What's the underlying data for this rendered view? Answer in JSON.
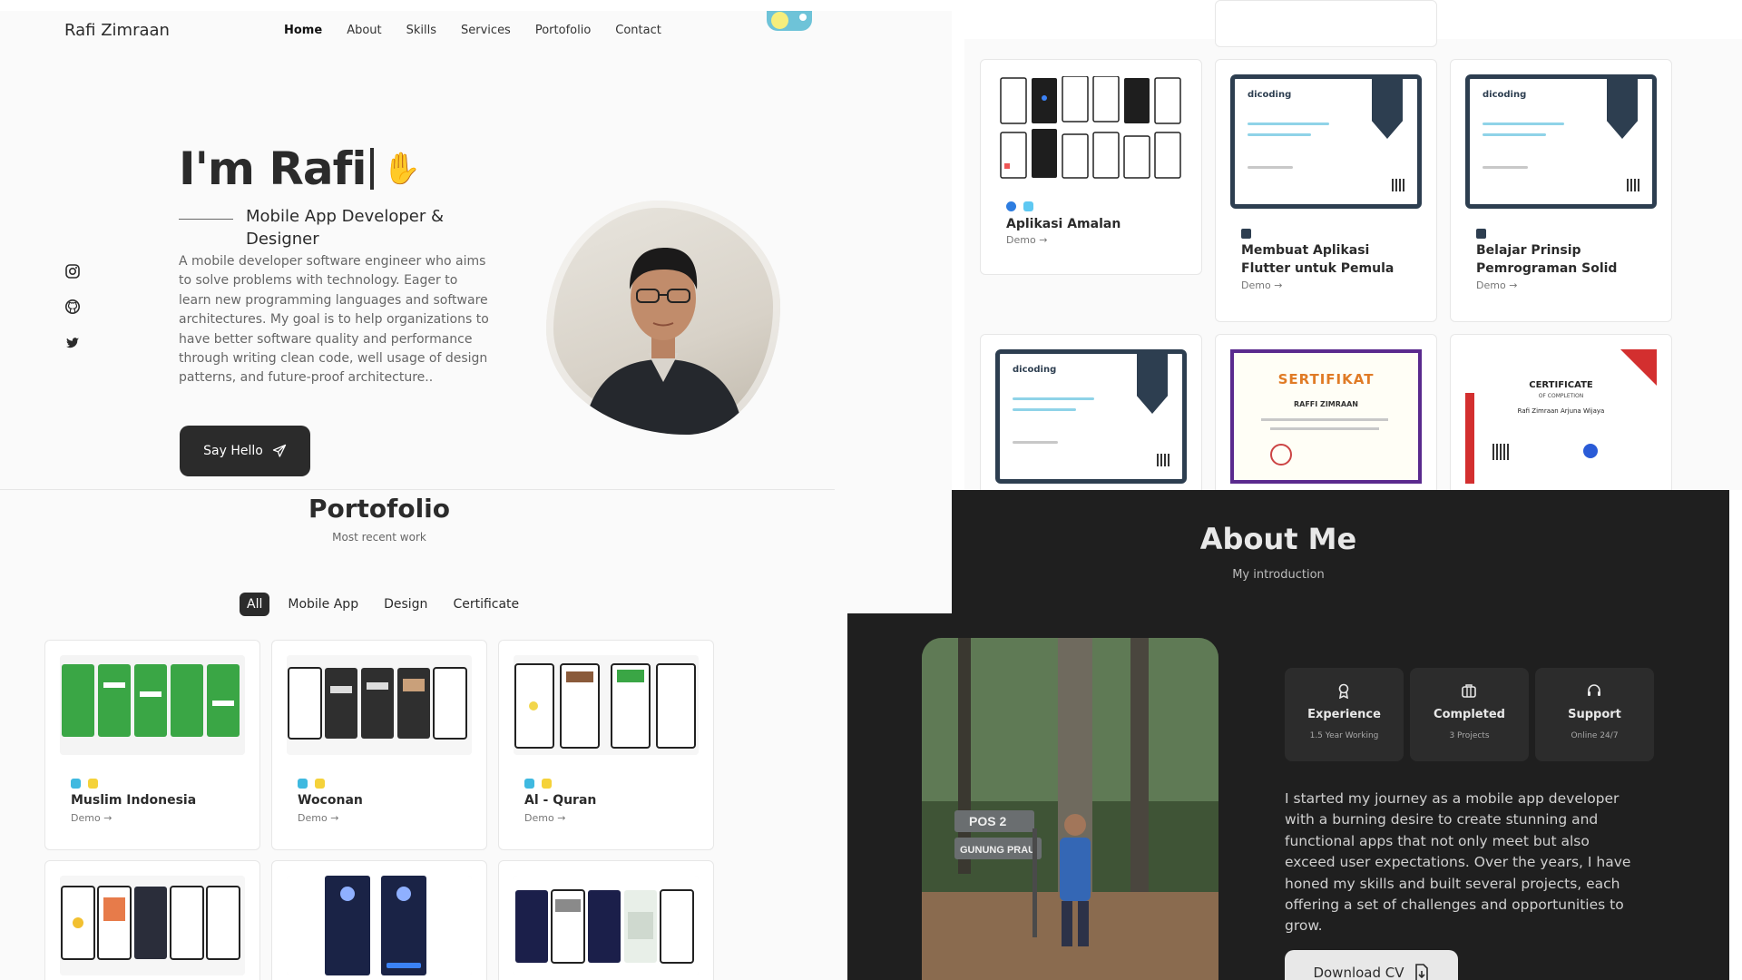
{
  "header": {
    "brand": "Rafi Zimraan",
    "nav": [
      "Home",
      "About",
      "Skills",
      "Services",
      "Portofolio",
      "Contact"
    ]
  },
  "hero": {
    "title": "I'm Rafi",
    "subtitle": "Mobile App Developer & Designer",
    "description": "A mobile developer software engineer who aims to solve problems with technology. Eager to learn new programming languages and software architectures. My goal is to help organizations to have better software quality and performance through writing clean code, well usage of design patterns, and future-proof architecture..",
    "button": "Say Hello"
  },
  "social": [
    "instagram-icon",
    "github-icon",
    "twitter-icon"
  ],
  "portfolio": {
    "title": "Portofolio",
    "subtitle": "Most recent work",
    "filters": [
      "All",
      "Mobile App",
      "Design",
      "Certificate"
    ],
    "cards": [
      {
        "name": "Muslim Indonesia",
        "demo": "Demo"
      },
      {
        "name": "Woconan",
        "demo": "Demo"
      },
      {
        "name": "Al - Quran",
        "demo": "Demo"
      }
    ]
  },
  "certificates": {
    "cards": [
      {
        "name": "Aplikasi Amalan",
        "demo": "Demo"
      },
      {
        "name": "Membuat Aplikasi Flutter untuk Pemula",
        "demo": "Demo"
      },
      {
        "name": "Belajar Prinsip Pemrograman Solid",
        "demo": "Demo"
      }
    ],
    "second_row": [
      {
        "logo": "dicoding"
      },
      {
        "title_word": "SERTIFIKAT",
        "recipient": "RAFFI ZIMRAAN"
      },
      {
        "heading": "CERTIFICATE",
        "subheading": "OF COMPLETION",
        "recipient": "Rafi Zimraan Arjuna Wijaya"
      }
    ],
    "cert_logo": "dicoding"
  },
  "about": {
    "title": "About Me",
    "subtitle": "My introduction",
    "stats": [
      {
        "title": "Experience",
        "sub": "1.5 Year Working"
      },
      {
        "title": "Completed",
        "sub": "3 Projects"
      },
      {
        "title": "Support",
        "sub": "Online 24/7"
      }
    ],
    "text": "I started my journey as a mobile app developer with a burning desire to create stunning and functional apps that not only meet but also exceed user expectations. Over the years, I have honed my skills and built several projects, each offering a set of challenges and opportunities to grow.",
    "button": "Download CV",
    "sign_pos": "POS 2",
    "sign_place": "GUNUNG PRAU"
  },
  "colors": {
    "dark": "#2b2b2b",
    "panel_dark": "#1f1f1f",
    "accent_toggle": "#6ec3d8",
    "sun": "#f6ee7c"
  }
}
